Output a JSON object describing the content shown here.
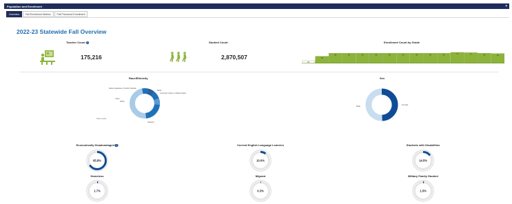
{
  "header": {
    "title": "Population and Enrollment",
    "collapse_icon": "chevron-down-icon"
  },
  "tabs": [
    {
      "label": "Overview",
      "active": true
    },
    {
      "label": "Fall Enrollment Metrics",
      "active": false
    },
    {
      "label": "Fall Preschool Enrollment",
      "active": false
    }
  ],
  "page_title": "2022-23 Statewide Fall Overview",
  "teacher": {
    "label": "Teacher Count",
    "value": "175,216",
    "icon": "classroom-icon"
  },
  "student": {
    "label": "Student Count",
    "value": "2,870,507",
    "icon": "walking-students-icon"
  },
  "enrollment_by_grade": {
    "label": "Enrollment Count by Grade",
    "bar_values": [
      "28",
      "48",
      "68",
      "68",
      "68",
      "68",
      "68",
      "68",
      "68",
      "68",
      "68",
      "74",
      "72",
      "68",
      "66"
    ]
  },
  "race": {
    "title": "Race/Ethnicity",
    "labels": [
      "Native Hawaiian or Pacific Islander",
      "Black",
      "American Indian or Alaska Native",
      "Asian",
      "White",
      "Two or more",
      "Hispanic"
    ]
  },
  "sex": {
    "title": "Sex",
    "labels": [
      "Female",
      "Male"
    ]
  },
  "rings": [
    {
      "label": "Economically Disadvantaged",
      "value": "65.8%",
      "pct": 65.8,
      "info": true
    },
    {
      "label": "Current English Language Learners",
      "value": "10.0%",
      "pct": 10.0,
      "info": false
    },
    {
      "label": "Students with Disabilities",
      "value": "14.5%",
      "pct": 14.5,
      "info": false
    },
    {
      "label": "Homeless",
      "value": "1.7%",
      "pct": 1.7,
      "info": false
    },
    {
      "label": "Migrant",
      "value": "0.3%",
      "pct": 0.3,
      "info": false
    },
    {
      "label": "Military Family Student",
      "value": "1.5%",
      "pct": 1.5,
      "info": false
    }
  ],
  "colors": {
    "navy": "#1f2d5c",
    "title_blue": "#1f6fb0",
    "ring_blue": "#0f4c96",
    "olive": "#8db43a",
    "light_blue": "#a9cbe8"
  }
}
